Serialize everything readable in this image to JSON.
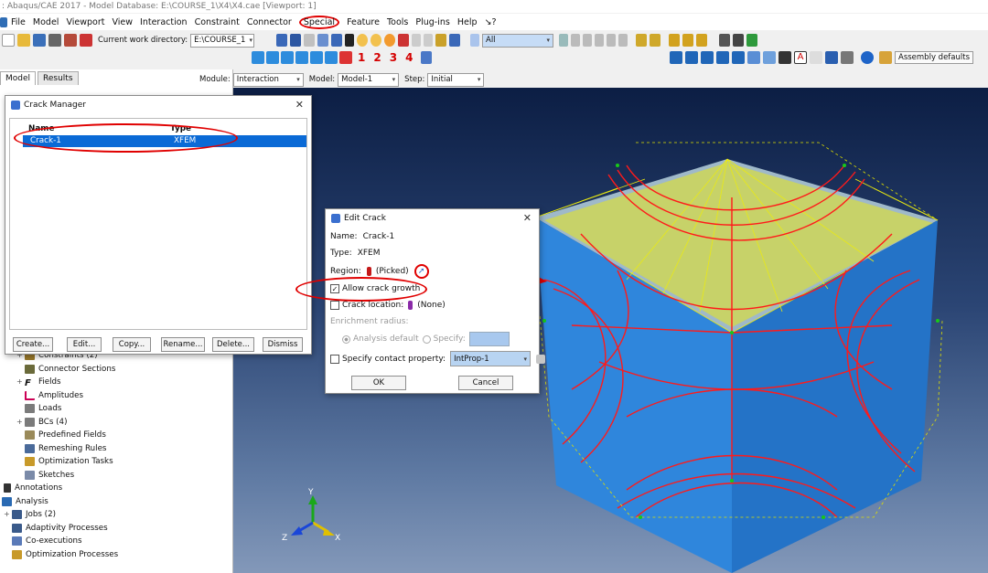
{
  "window": {
    "title": ": Abaqus/CAE 2017 - Model Database: E:\\COURSE_1\\X4\\X4.cae [Viewport: 1]"
  },
  "menu": [
    "File",
    "Model",
    "Viewport",
    "View",
    "Interaction",
    "Constraint",
    "Connector",
    "Special",
    "Feature",
    "Tools",
    "Plug-ins",
    "Help",
    "↘?"
  ],
  "toolbar": {
    "cwd_label": "Current work directory:",
    "cwd_value": "E:\\COURSE_1",
    "select_value": "All",
    "view_numbers": [
      "1",
      "2",
      "3",
      "4"
    ],
    "assembly_defaults": "Assembly defaults"
  },
  "module_bar": {
    "module_label": "Module:",
    "module_value": "Interaction",
    "model_label": "Model:",
    "model_value": "Model-1",
    "step_label": "Step:",
    "step_value": "Initial"
  },
  "tabs": [
    "Model",
    "Results"
  ],
  "tree": [
    {
      "label": "Constraints (2)",
      "expander": "+"
    },
    {
      "label": "Connector Sections",
      "expander": ""
    },
    {
      "label": "Fields",
      "expander": "+"
    },
    {
      "label": "Amplitudes",
      "expander": ""
    },
    {
      "label": "Loads",
      "expander": ""
    },
    {
      "label": "BCs (4)",
      "expander": "+"
    },
    {
      "label": "Predefined Fields",
      "expander": ""
    },
    {
      "label": "Remeshing Rules",
      "expander": ""
    },
    {
      "label": "Optimization Tasks",
      "expander": ""
    },
    {
      "label": "Sketches",
      "expander": ""
    },
    {
      "label": "Annotations",
      "expander": ""
    },
    {
      "label": "Analysis",
      "expander": ""
    },
    {
      "label": "Jobs (2)",
      "expander": "+"
    },
    {
      "label": "Adaptivity Processes",
      "expander": ""
    },
    {
      "label": "Co-executions",
      "expander": ""
    },
    {
      "label": "Optimization Processes",
      "expander": ""
    }
  ],
  "crack_manager": {
    "title": "Crack Manager",
    "col_name": "Name",
    "col_type": "Type",
    "rows": [
      {
        "name": "Crack-1",
        "type": "XFEM"
      }
    ],
    "buttons": [
      "Create...",
      "Edit...",
      "Copy...",
      "Rename...",
      "Delete...",
      "Dismiss"
    ]
  },
  "edit_crack": {
    "title": "Edit Crack",
    "name_label": "Name:",
    "name_value": "Crack-1",
    "type_label": "Type:",
    "type_value": "XFEM",
    "region_label": "Region:",
    "region_value": "(Picked)",
    "allow_growth": "Allow crack growth",
    "crack_location_label": "Crack location:",
    "crack_location_value": "(None)",
    "enrichment_label": "Enrichment radius:",
    "analysis_default": "Analysis default",
    "specify": "Specify:",
    "contact_label": "Specify contact property:",
    "contact_value": "IntProp-1",
    "ok": "OK",
    "cancel": "Cancel"
  },
  "triad": {
    "x": "X",
    "y": "Y",
    "z": "Z"
  },
  "colors": {
    "highlight": "#0a6ad6",
    "annotation": "#e00000",
    "crack_lines": "#ff1a1a",
    "mesh_yellow": "#f0f000",
    "cube_face": "#2d86df"
  }
}
